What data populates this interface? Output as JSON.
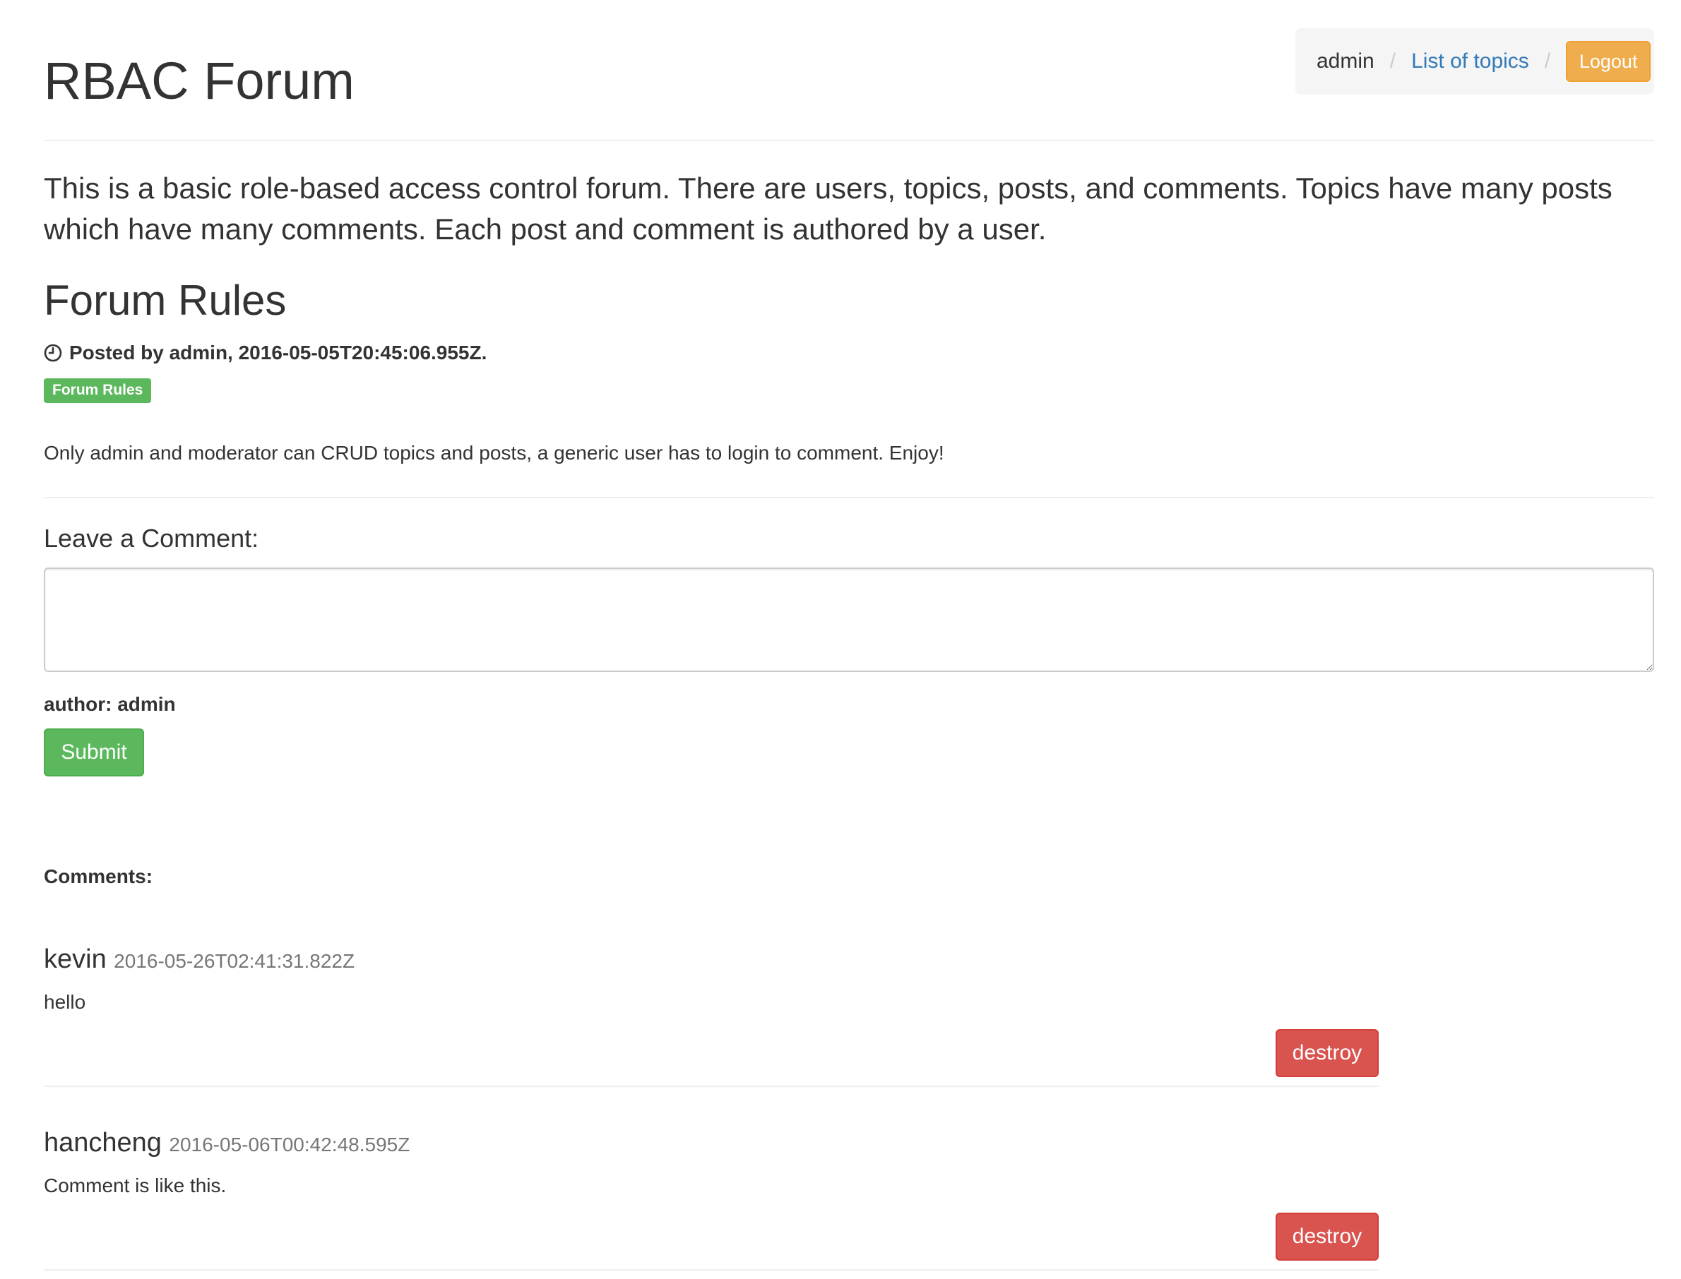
{
  "header": {
    "title": "RBAC Forum",
    "breadcrumb": {
      "user": "admin",
      "separator": "/",
      "topics_link": "List of topics",
      "logout_label": "Logout"
    }
  },
  "intro": "This is a basic role-based access control forum. There are users, topics, posts, and comments. Topics have many posts which have many comments. Each post and comment is authored by a user.",
  "post": {
    "title": "Forum Rules",
    "meta": "Posted by admin, 2016-05-05T20:45:06.955Z.",
    "meta_icon": "clock-icon",
    "tag": "Forum Rules",
    "body": "Only admin and moderator can CRUD topics and posts, a generic user has to login to comment. Enjoy!"
  },
  "comment_form": {
    "heading": "Leave a Comment:",
    "value": "",
    "author_label": "author: admin",
    "submit_label": "Submit"
  },
  "comments": {
    "label": "Comments:",
    "items": [
      {
        "author": "kevin",
        "timestamp": "2016-05-26T02:41:31.822Z",
        "text": "hello",
        "destroy_label": "destroy"
      },
      {
        "author": "hancheng",
        "timestamp": "2016-05-06T00:42:48.595Z",
        "text": "Comment is like this.",
        "destroy_label": "destroy"
      }
    ]
  },
  "colors": {
    "success": "#5cb85c",
    "warning": "#f0ad4e",
    "danger": "#d9534f",
    "link": "#337ab7"
  }
}
